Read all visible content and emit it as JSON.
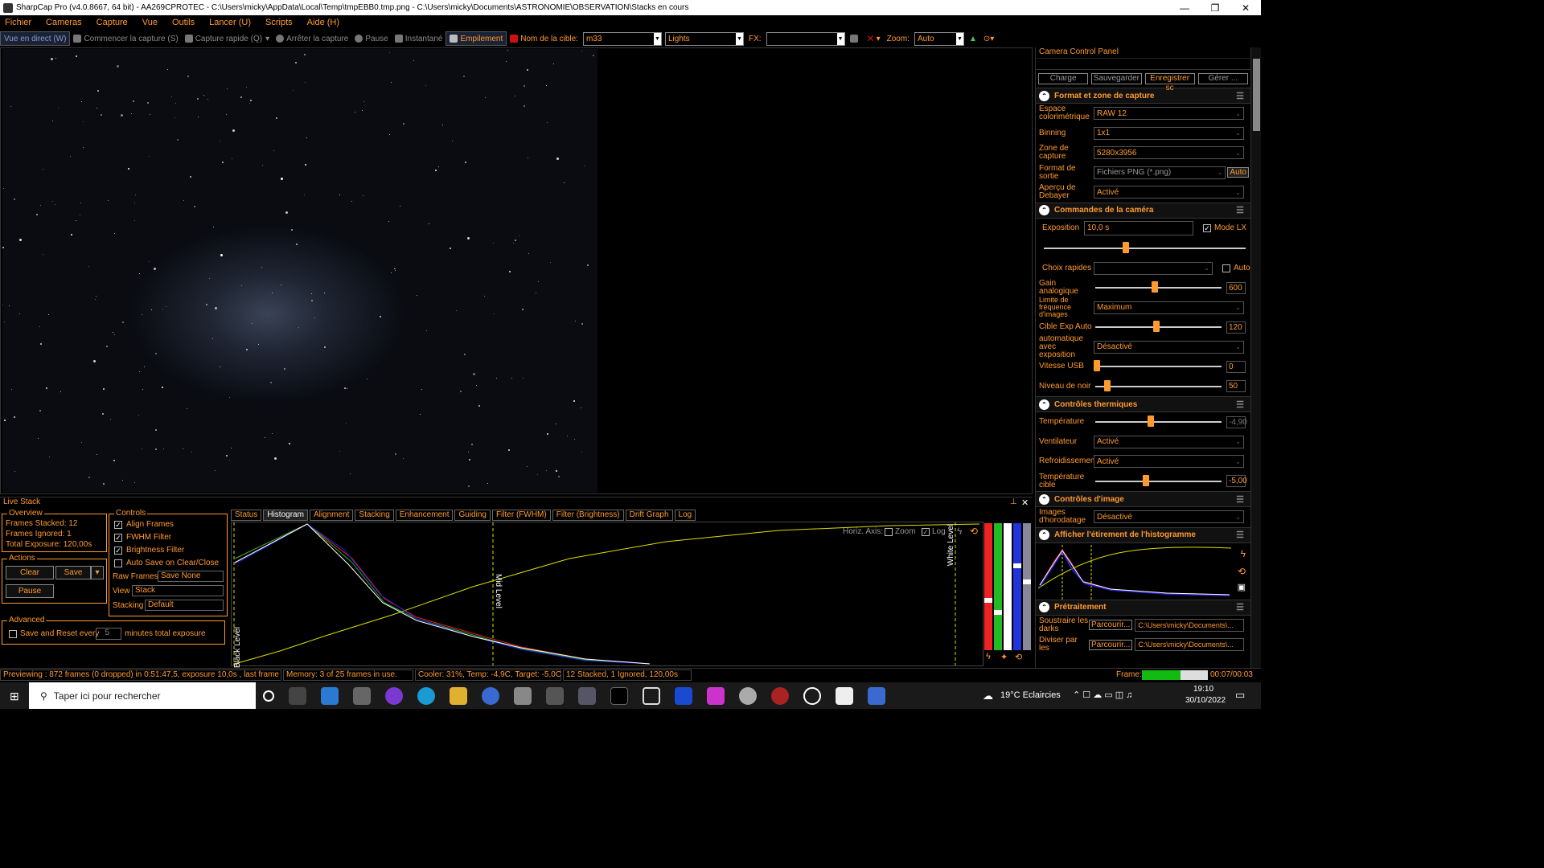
{
  "window": {
    "title": "SharpCap Pro (v4.0.8667, 64 bit) - AA269CPROTEC - C:\\Users\\micky\\AppData\\Local\\Temp\\tmpEBB0.tmp.png - C:\\Users\\micky\\Documents\\ASTRONOMIE\\OBSERVATION\\Stacks en cours",
    "min": "—",
    "max": "❐",
    "close": "✕"
  },
  "menu": [
    "Fichier",
    "Cameras",
    "Capture",
    "Vue",
    "Outils",
    "Lancer (U)",
    "Scripts",
    "Aide (H)"
  ],
  "toolbar": {
    "live_view": "Vue en direct (W)",
    "start_capture": "Commencer la capture (S)",
    "quick_capture": "Capture rapide (Q)",
    "stop_capture": "Arrêter la capture",
    "pause": "Pause",
    "snapshot": "Instantané",
    "stacking": "Empilement",
    "target_label": "Nom de la cible:",
    "target_value": "m33",
    "frame_type": "Lights",
    "fx_label": "FX:",
    "fx_value": "",
    "zoom_label": "Zoom:",
    "zoom_value": "Auto"
  },
  "ccp": {
    "title": "Camera Control Panel",
    "buttons": [
      "Charge",
      "Sauvegarder",
      "Enregistrer sc",
      "Gérer ..."
    ],
    "format_section": "Format et zone de capture",
    "color_space_label": "Espace colorimétrique",
    "color_space": "RAW 12",
    "binning_label": "Binning",
    "binning": "1x1",
    "capture_area_label": "Zone de capture",
    "capture_area": "5280x3956",
    "output_format_label": "Format de sortie",
    "output_format": "Fichiers PNG (*.png)",
    "output_auto": "Auto",
    "debayer_label": "Aperçu de Debayer",
    "debayer": "Activé",
    "camera_section": "Commandes de la caméra",
    "exposure_label": "Exposition",
    "exposure": "10,0 s",
    "lx_label": "Mode LX",
    "quick_label": "Choix rapides",
    "quick_auto": "Auto",
    "gain_label": "Gain analogique",
    "gain": "600",
    "fps_label": "Limite de fréquence d'images",
    "fps": "Maximum",
    "auto_exp_label": "Cible Exp Auto",
    "auto_exp": "120",
    "auto_exposure_label": "automatique avec exposition",
    "auto_exposure": "Désactivé",
    "usb_label": "Vitesse USB",
    "usb": "0",
    "black_label": "Niveau de noir",
    "black": "50",
    "thermal_section": "Contrôles thermiques",
    "temp_label": "Température",
    "temp": "-4,90",
    "fan_label": "Ventilateur",
    "fan": "Activé",
    "cooling_label": "Refroidissement",
    "cooling": "Activé",
    "target_temp_label": "Température cible",
    "target_temp": "-5,00",
    "image_section": "Contrôles d'image",
    "timestamp_label": "Images d'horodatage",
    "timestamp": "Désactivé",
    "histo_section": "Afficher l'étirement de l'histogramme",
    "preproc_section": "Prétraitement",
    "darks_label": "Soustraire les darks",
    "darks_browse": "Parcourir...",
    "darks_path": "C:\\Users\\micky\\Documents\\...",
    "flats_label": "Diviser par les",
    "flats_browse": "Parcourir...",
    "flats_path": "C:\\Users\\micky\\Documents\\..."
  },
  "livestack": {
    "title": "Live Stack",
    "overview_label": "Overview",
    "stacked": "Frames Stacked:  12",
    "ignored": "Frames Ignored:   1",
    "total": "Total Exposure:   120,00s",
    "actions_label": "Actions",
    "clear": "Clear",
    "save": "Save",
    "pause": "Pause",
    "advanced_label": "Advanced",
    "reset_label": "Save and Reset every",
    "reset_value": "5",
    "reset_suffix": "minutes total exposure",
    "controls_label": "Controls",
    "align": "Align Frames",
    "fwhm": "FWHM Filter",
    "brightness": "Brightness Filter",
    "autosave": "Auto Save on Clear/Close",
    "raw_label": "Raw Frames",
    "raw_value": "Save None",
    "view_label": "View",
    "view_value": "Stack",
    "stacking_label": "Stacking",
    "stacking_value": "Default",
    "tabs": [
      "Status",
      "Histogram",
      "Alignment",
      "Stacking",
      "Enhancement",
      "Guiding",
      "Filter (FWHM)",
      "Filter (Brightness)",
      "Drift Graph",
      "Log"
    ],
    "horiz_axis": "Horiz. Axis:",
    "zoom": "Zoom",
    "log": "Log",
    "black_level": "Black Level",
    "mid_level": "Mid Level",
    "white_level": "White Level"
  },
  "status": {
    "preview": "Previewing : 872 frames (0 dropped) in 0:51:47,5, exposure 10,0s , last frame 10,5s",
    "memory": "Memory: 3 of 25 frames in use.",
    "cooler": "Cooler: 31%, Temp: -4,9C, Target: -5,0C",
    "stack": "12 Stacked, 1 Ignored, 120,00s",
    "frame_label": "Frame:",
    "frame_time": "00:07/00:03"
  },
  "taskbar": {
    "search": "Taper ici pour rechercher",
    "weather": "19°C  Eclaircies",
    "time": "19:10",
    "date": "30/10/2022"
  },
  "colors": {
    "accent": "#ff9a2e",
    "background": "#000000"
  }
}
